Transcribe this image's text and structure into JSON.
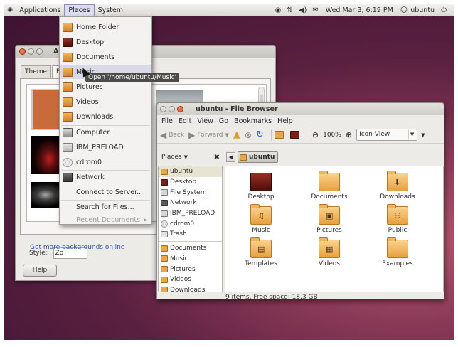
{
  "top_panel": {
    "menus": [
      "Applications",
      "Places",
      "System"
    ],
    "clock": "Wed Mar  3,  6:19 PM",
    "user": "ubuntu",
    "icons": [
      "wifi-icon",
      "network-icon",
      "volume-icon",
      "mail-icon",
      "user-icon",
      "power-icon"
    ]
  },
  "appearance_window": {
    "title": "App",
    "tabs": [
      "Theme",
      "Bac"
    ],
    "style_label": "Style:",
    "style_value": "Zo",
    "get_more_link": "Get more backgrounds online",
    "help_button": "Help"
  },
  "places_menu": {
    "items": [
      {
        "label": "Home Folder",
        "icon": "home-folder-icon"
      },
      {
        "label": "Desktop",
        "icon": "desktop-icon"
      },
      {
        "label": "Documents",
        "icon": "documents-folder-icon"
      },
      {
        "label": "Music",
        "icon": "music-folder-icon"
      },
      {
        "label": "Pictures",
        "icon": "pictures-folder-icon"
      },
      {
        "label": "Videos",
        "icon": "videos-folder-icon"
      },
      {
        "label": "Downloads",
        "icon": "downloads-folder-icon"
      },
      {
        "label": "Computer",
        "icon": "computer-icon"
      },
      {
        "label": "IBM_PRELOAD",
        "icon": "drive-icon"
      },
      {
        "label": "cdrom0",
        "icon": "cdrom-icon"
      },
      {
        "label": "Network",
        "icon": "network-icon"
      },
      {
        "label": "Connect to Server..."
      },
      {
        "label": "Search for Files..."
      },
      {
        "label": "Recent Documents"
      }
    ],
    "tooltip": "Open '/home/ubuntu/Music'"
  },
  "file_browser": {
    "title": "ubuntu - File Browser",
    "menus": [
      "File",
      "Edit",
      "View",
      "Go",
      "Bookmarks",
      "Help"
    ],
    "toolbar": {
      "back": "Back",
      "forward": "Forward",
      "zoom": "100%",
      "view_mode": "Icon View"
    },
    "sidebar_header": "Places",
    "path_button": "ubuntu",
    "sidebar_items": [
      {
        "label": "ubuntu",
        "icon": "folder"
      },
      {
        "label": "Desktop",
        "icon": "desk"
      },
      {
        "label": "File System",
        "icon": "drive"
      },
      {
        "label": "Network",
        "icon": "net"
      },
      {
        "label": "IBM_PRELOAD",
        "icon": "drive"
      },
      {
        "label": "cdrom0",
        "icon": "disc"
      },
      {
        "label": "Trash",
        "icon": "trash"
      }
    ],
    "bookmark_items": [
      "Documents",
      "Music",
      "Pictures",
      "Videos",
      "Downloads"
    ],
    "files": [
      {
        "name": "Desktop",
        "emblem": ""
      },
      {
        "name": "Documents",
        "emblem": ""
      },
      {
        "name": "Downloads",
        "emblem": "⬇"
      },
      {
        "name": "Music",
        "emblem": "♫"
      },
      {
        "name": "Pictures",
        "emblem": "▣"
      },
      {
        "name": "Public",
        "emblem": "⚇"
      },
      {
        "name": "Templates",
        "emblem": "▤"
      },
      {
        "name": "Videos",
        "emblem": "▦"
      },
      {
        "name": "Examples",
        "emblem": ""
      }
    ],
    "status": "9 items, Free space: 18.3 GB"
  }
}
